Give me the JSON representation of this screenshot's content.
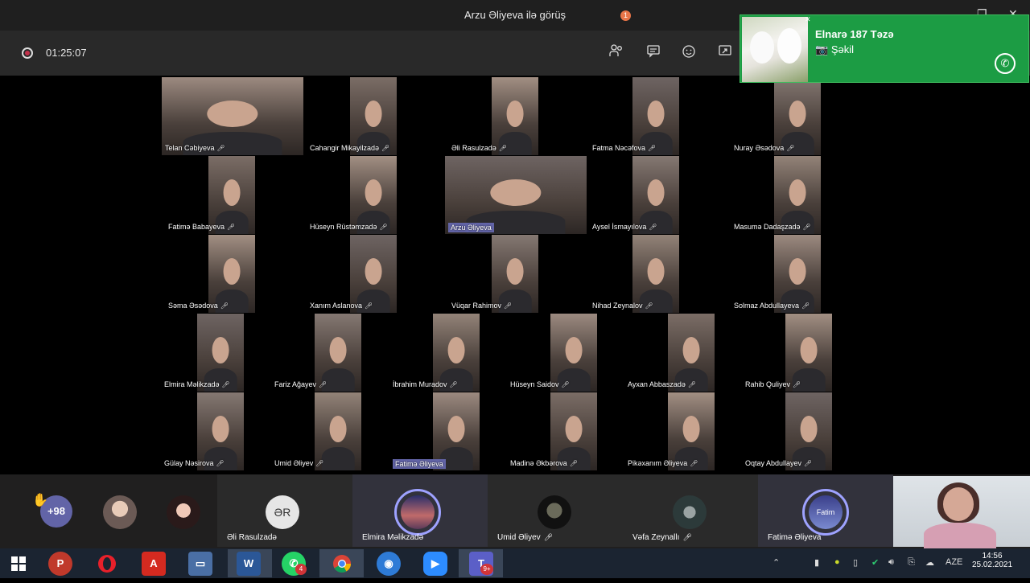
{
  "window": {
    "title": "Arzu Əliyeva ilə görüş",
    "minimize": "—",
    "maximize": "❐",
    "close": "✕"
  },
  "meeting": {
    "timer": "01:25:07",
    "participants_badge": "1",
    "icons": [
      "participants-icon",
      "chat-icon",
      "reactions-icon",
      "share-icon"
    ]
  },
  "notification": {
    "sender": "Elnarə 187 Təzə",
    "message": "Şəkil",
    "camera_glyph": "📷"
  },
  "grid": {
    "rows": [
      [
        "Telan Cəbiyeva",
        "Cahangir Mikayilzadə",
        "Əli Rasulzadə",
        "Fatma Nəcəfova",
        "Nuray Əsədova"
      ],
      [
        "Fatimə Babayeva",
        "Hüseyn Rüstəmzadə",
        "Arzu Əliyeva",
        "Aysel İsmayılova",
        "Masumə Dadaşzadə"
      ],
      [
        "Səma Əsədova",
        "Xanım Aslanova",
        "Vüqar Rahimov",
        "Nihad Zeynalov",
        "Solmaz Abdullayeva"
      ],
      [
        "Elmira Məlikzadə",
        "Fariz Ağayev",
        "İbrahim Muradov",
        "Hüseyn Saidov",
        "Ayxan Abbaszadə",
        "Rahib Quliyev"
      ],
      [
        "Gülay Nəsirova",
        "Umid Əliyev",
        "Fatimə Əliyeva",
        "Madinə Əkbərova",
        "Pikəxanım Əliyeva",
        "Oqtay Abdullayev"
      ]
    ]
  },
  "strip": {
    "more_count": "+98",
    "initials": "ƏR",
    "participants": [
      {
        "name": "Əli Rasulzadə"
      },
      {
        "name": "Elmira Məlikzadə"
      },
      {
        "name": "Umid Əliyev",
        "muted": true
      },
      {
        "name": "Vəfa Zeynallı",
        "muted": true
      },
      {
        "name": "Fatimə Əliyeva"
      }
    ],
    "ring_text": "Fatim"
  },
  "taskbar": {
    "whatsapp_badge": "4",
    "teams_badge": "9+",
    "language": "AZE",
    "time": "14:56",
    "date": "25.02.2021",
    "apps": [
      "windows-start",
      "psiphon",
      "opera",
      "acrobat",
      "network",
      "word",
      "whatsapp",
      "chrome",
      "browser",
      "zoom",
      "teams"
    ]
  },
  "colors": {
    "teams_purple": "#6264a7",
    "whatsapp_green": "#1c9c44",
    "taskbar": "#1b2431"
  }
}
